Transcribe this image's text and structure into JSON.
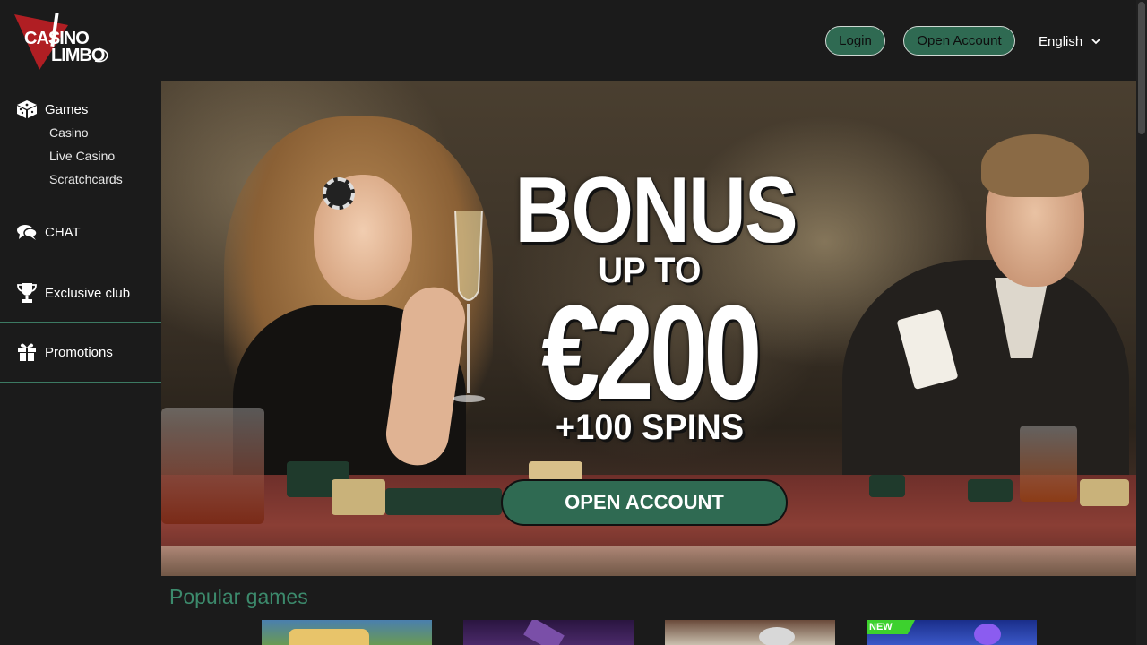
{
  "brand": {
    "logo_line1": "CASINO",
    "logo_line2": "LIMBO",
    "accent": "#2f6a52",
    "link_green": "#3c8a6c"
  },
  "header": {
    "login_label": "Login",
    "open_account_label": "Open Account",
    "language": "English"
  },
  "sidebar": {
    "games": {
      "label": "Games",
      "icon": "dice-icon",
      "items": [
        "Casino",
        "Live Casino",
        "Scratchcards"
      ]
    },
    "chat": {
      "label": "CHAT",
      "icon": "chat-bubbles-icon"
    },
    "club": {
      "label": "Exclusive club",
      "icon": "trophy-icon"
    },
    "promotions": {
      "label": "Promotions",
      "icon": "gift-icon"
    }
  },
  "hero": {
    "line1": "BONUS",
    "line2": "UP TO",
    "amount": "€200",
    "spins": "+100 SPINS",
    "cta_label": "OPEN ACCOUNT"
  },
  "popular": {
    "title": "Popular games",
    "badge_new": "NEW"
  }
}
